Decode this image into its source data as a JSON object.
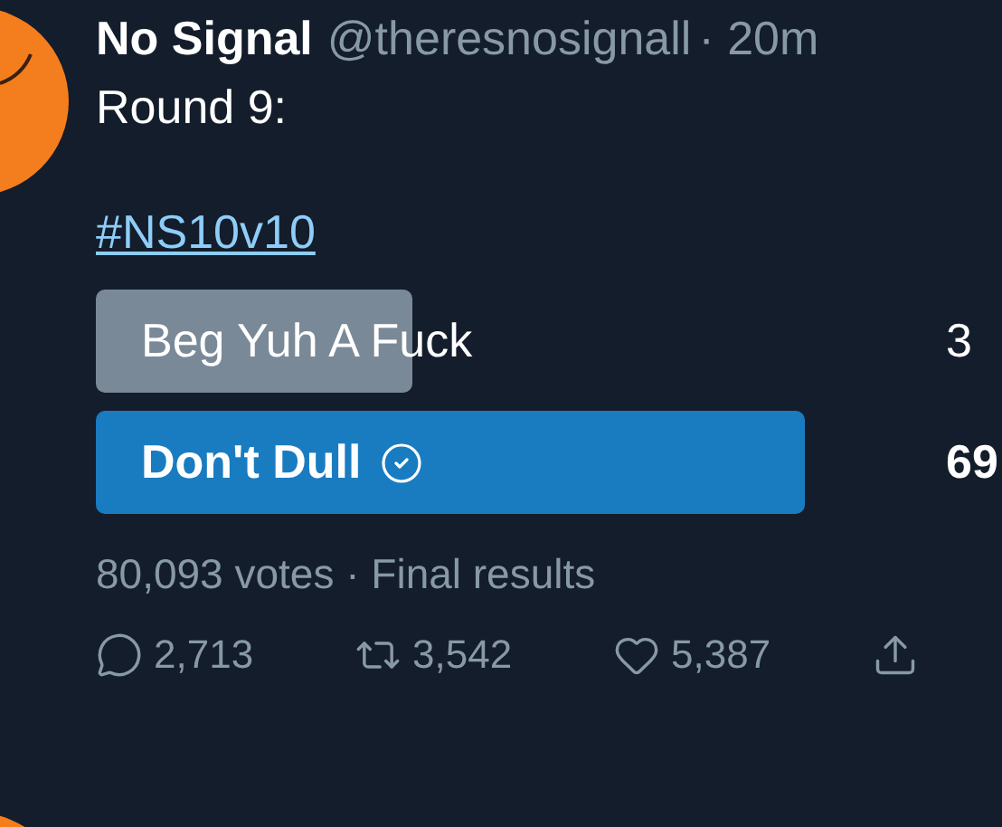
{
  "tweet": {
    "name": "No Signal",
    "handle": "@theresnosignall",
    "time": "· 20m",
    "text": "Round 9:",
    "hashtag": "#NS10v10"
  },
  "poll": {
    "options": [
      {
        "label": "Beg Yuh A Fuck",
        "percent": "3",
        "selected": false
      },
      {
        "label": "Don't Dull",
        "percent": "69",
        "selected": true
      }
    ],
    "votes": "80,093 votes",
    "status": "· Final results"
  },
  "actions": [
    {
      "kind": "reply",
      "count": "2,713"
    },
    {
      "kind": "retweet",
      "count": "3,542"
    },
    {
      "kind": "like",
      "count": "5,387"
    },
    {
      "kind": "share"
    }
  ]
}
